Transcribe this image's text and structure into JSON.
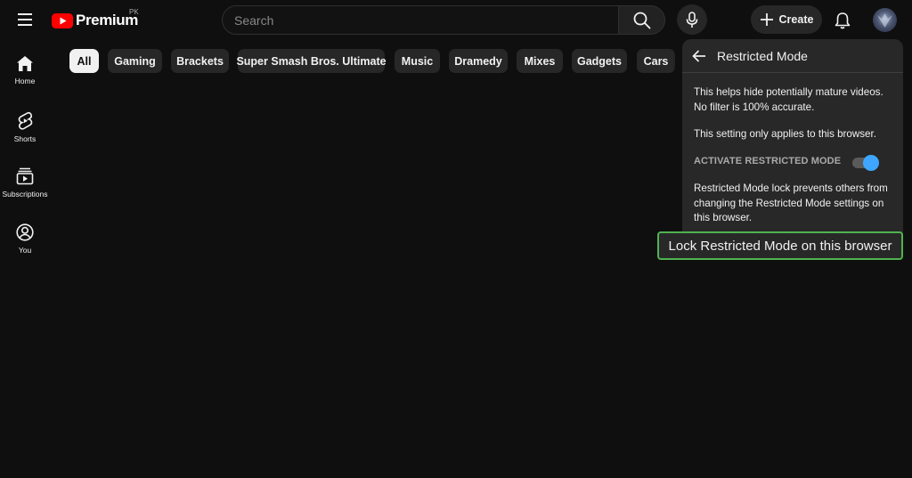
{
  "header": {
    "logo_text": "Premium",
    "region": "PK",
    "search_placeholder": "Search",
    "create_label": "Create"
  },
  "sidebar": {
    "items": [
      {
        "label": "Home",
        "icon": "home-icon"
      },
      {
        "label": "Shorts",
        "icon": "shorts-icon"
      },
      {
        "label": "Subscriptions",
        "icon": "subscriptions-icon"
      },
      {
        "label": "You",
        "icon": "you-icon"
      }
    ]
  },
  "chips": [
    "All",
    "Gaming",
    "Brackets",
    "Super Smash Bros. Ultimate",
    "Music",
    "Dramedy",
    "Mixes",
    "Gadgets",
    "Cars"
  ],
  "active_chip": "All",
  "panel": {
    "title": "Restricted Mode",
    "description": "This helps hide potentially mature videos. No filter is 100% accurate.",
    "browser_note": "This setting only applies to this browser.",
    "toggle_label": "ACTIVATE RESTRICTED MODE",
    "toggle_on": true,
    "lock_description": "Restricted Mode lock prevents others from changing the Restricted Mode settings on this browser.",
    "lock_button": "Lock Restricted Mode on this browser"
  },
  "colors": {
    "background": "#0f0f0f",
    "accent_blue": "#3ea6ff",
    "brand_red": "#ff0000",
    "focus_green": "#4fb34f"
  }
}
